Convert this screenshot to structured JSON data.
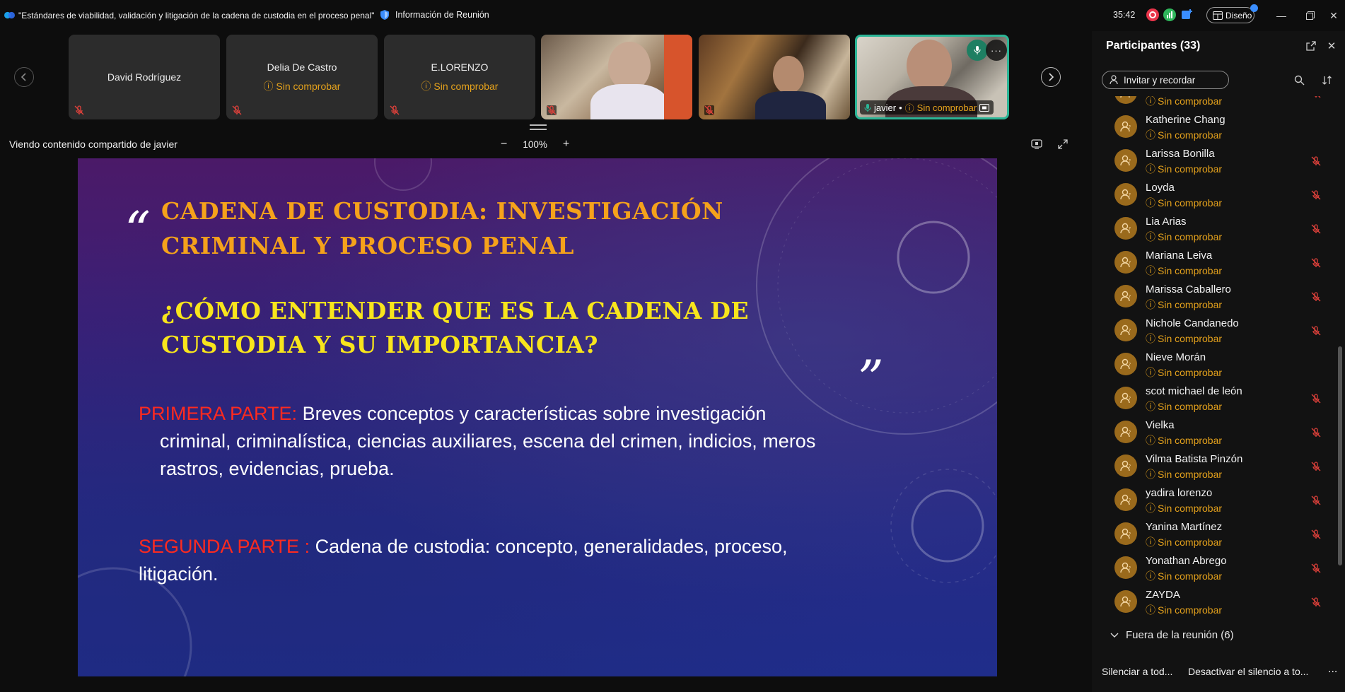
{
  "titlebar": {
    "meeting_title": "\"Estándares de viabilidad, validación y litigación de la cadena de custodia en el proceso penal\"",
    "meeting_info": "Información de Reunión",
    "timer": "35:42",
    "design_label": "Diseño"
  },
  "filmstrip": {
    "tiles": [
      {
        "name": "David Rodríguez",
        "status": ""
      },
      {
        "name": "Delia De Castro",
        "status": "Sin comprobar"
      },
      {
        "name": "E.LORENZO",
        "status": "Sin comprobar"
      }
    ],
    "speaker": {
      "name": "javier",
      "status": "Sin comprobar"
    }
  },
  "share": {
    "label": "Viendo contenido compartido de javier",
    "zoom": "100%"
  },
  "slide": {
    "heading": "CADENA DE CUSTODIA:  INVESTIGACIÓN CRIMINAL Y PROCESO PENAL",
    "question": "¿CÓMO ENTENDER QUE ES LA CADENA DE CUSTODIA Y SU IMPORTANCIA?",
    "part1_label": "PRIMERA PARTE:",
    "part1_line1": " Breves conceptos y características sobre investigación",
    "part1_line2": "criminal, criminalística, ciencias auxiliares, escena del crimen, indicios, meros",
    "part1_line3": "rastros, evidencias, prueba.",
    "part2_label": "SEGUNDA PARTE :",
    "part2_line1": " Cadena de custodia: concepto, generalidades, proceso,",
    "part2_line2": "litigación.",
    "colors": {
      "heading": "#f5a21b",
      "question": "#f8e51c",
      "label": "#ff2a1f"
    }
  },
  "participants": {
    "title": "Participantes (33)",
    "invite_label": "Invitar y recordar",
    "items": [
      {
        "name": "",
        "status": "Sin comprobar",
        "muted": true
      },
      {
        "name": "Katherine Chang",
        "status": "Sin comprobar",
        "muted": false
      },
      {
        "name": "Larissa Bonilla",
        "status": "Sin comprobar",
        "muted": true
      },
      {
        "name": "Loyda",
        "status": "Sin comprobar",
        "muted": true
      },
      {
        "name": "Lia Arias",
        "status": "Sin comprobar",
        "muted": true
      },
      {
        "name": "Mariana Leiva",
        "status": "Sin comprobar",
        "muted": true
      },
      {
        "name": "Marissa Caballero",
        "status": "Sin comprobar",
        "muted": true
      },
      {
        "name": "Nichole Candanedo",
        "status": "Sin comprobar",
        "muted": true
      },
      {
        "name": "Nieve Morán",
        "status": "Sin comprobar",
        "muted": false
      },
      {
        "name": "scot michael de león",
        "status": "Sin comprobar",
        "muted": true
      },
      {
        "name": "Vielka",
        "status": "Sin comprobar",
        "muted": true
      },
      {
        "name": "Vilma Batista Pinzón",
        "status": "Sin comprobar",
        "muted": true
      },
      {
        "name": "yadira lorenzo",
        "status": "Sin comprobar",
        "muted": true
      },
      {
        "name": "Yanina Martínez",
        "status": "Sin comprobar",
        "muted": true
      },
      {
        "name": "Yonathan Abrego",
        "status": "Sin comprobar",
        "muted": true
      },
      {
        "name": "ZAYDA",
        "status": "Sin comprobar",
        "muted": true
      }
    ],
    "outside_label": "Fuera de la reunión (6)",
    "mute_all": "Silenciar a tod...",
    "unmute_all": "Desactivar el silencio a to...",
    "more": "..."
  },
  "colors": {
    "accent": "#2bb596",
    "warning": "#e5a21c",
    "muted_mic": "#e0413b",
    "avatar": "#9a6a1c"
  }
}
